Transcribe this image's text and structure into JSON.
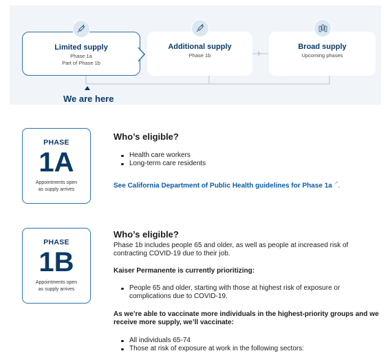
{
  "supply_stages": [
    {
      "title": "Limited supply",
      "lines": [
        "Phase 1a",
        "Part of Phase 1b"
      ],
      "icon": "syringe-icon"
    },
    {
      "title": "Additional supply",
      "lines": [
        "Phase 1b"
      ],
      "icon": "syringe-icon"
    },
    {
      "title": "Broad supply",
      "lines": [
        "Upcoming phases"
      ],
      "icon": "vials-icon"
    }
  ],
  "we_are_here": "We are here",
  "phase_1a": {
    "label": "PHASE",
    "code": "1A",
    "note": [
      "Appointments open",
      "as supply arrives"
    ],
    "heading": "Who’s eligible?",
    "bullets": [
      "Health care workers",
      "Long-term care residents"
    ],
    "link": "See California Department of Public Health guidelines for Phase 1a",
    "link_suffix": "."
  },
  "phase_1b": {
    "label": "PHASE",
    "code": "1B",
    "note": [
      "Appointments open",
      "as supply arrives"
    ],
    "heading": "Who’s eligible?",
    "intro": "Phase 1b includes people 65 and older, as well as people at increased risk of contracting COVID-19 due to their job.",
    "prioritizing_heading": "Kaiser Permanente is currently prioritizing:",
    "prioritizing_bullets": [
      "People 65 and older, starting with those at highest risk of exposure or complications due to COVID-19."
    ],
    "next_heading": "As we’re able to vaccinate more individuals in the highest-priority groups and we receive more supply, we’ll vaccinate:",
    "next_bullets": [
      "All individuals 65-74",
      "Those at risk of exposure at work in the following sectors:"
    ]
  },
  "colors": {
    "brand_blue": "#0b3a66",
    "link_blue": "#0b5da8",
    "border_blue": "#2c73a8",
    "banner_bg": "#f1f5f9"
  }
}
